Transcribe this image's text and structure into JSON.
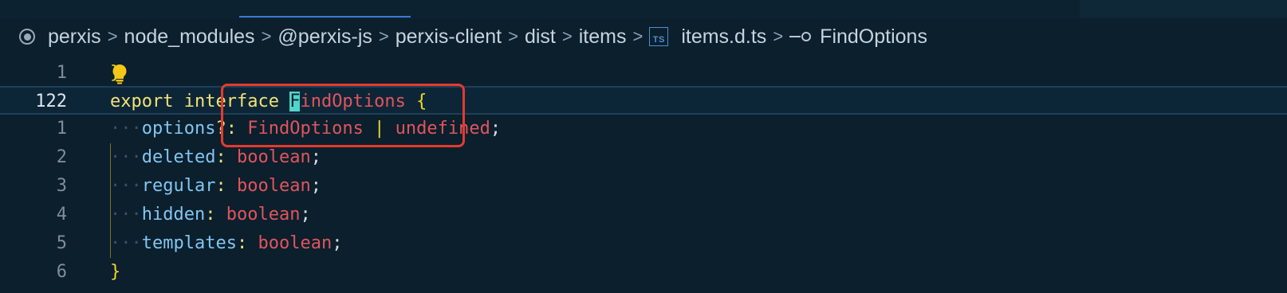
{
  "breadcrumb": {
    "items": [
      {
        "label": "perxis"
      },
      {
        "label": "node_modules"
      },
      {
        "label": "@perxis-js"
      },
      {
        "label": "perxis-client"
      },
      {
        "label": "dist"
      },
      {
        "label": "items"
      },
      {
        "label": "items.d.ts",
        "icon": "ts-file-icon",
        "icon_text": "TS"
      },
      {
        "label": "FindOptions",
        "icon": "interface-symbol-icon"
      }
    ],
    "separator": ">"
  },
  "editor": {
    "lines": [
      {
        "num": "1",
        "text": "}"
      },
      {
        "num": "122",
        "kw1": "export",
        "kw2": "interface",
        "name_first": "F",
        "name_rest": "indOptions",
        "brace": "{"
      },
      {
        "num": "1",
        "dots": "···",
        "prop": "options",
        "opt": "?:",
        "type": "FindOptions",
        "bar": "|",
        "type2": "undefined",
        "end": ";"
      },
      {
        "num": "2",
        "dots": "···",
        "prop": "deleted",
        "colon": ":",
        "type": "boolean",
        "end": ";"
      },
      {
        "num": "3",
        "dots": "···",
        "prop": "regular",
        "colon": ":",
        "type": "boolean",
        "end": ";"
      },
      {
        "num": "4",
        "dots": "···",
        "prop": "hidden",
        "colon": ":",
        "type": "boolean",
        "end": ";"
      },
      {
        "num": "5",
        "dots": "···",
        "prop": "templates",
        "colon": ":",
        "type": "boolean",
        "end": ";"
      },
      {
        "num": "6",
        "text": "}"
      }
    ]
  },
  "colors": {
    "background": "#0b1f2d",
    "keyword": "#f2e27a",
    "type": "#e0555c",
    "property": "#83c6f0",
    "highlight_box": "#e53a2e"
  }
}
